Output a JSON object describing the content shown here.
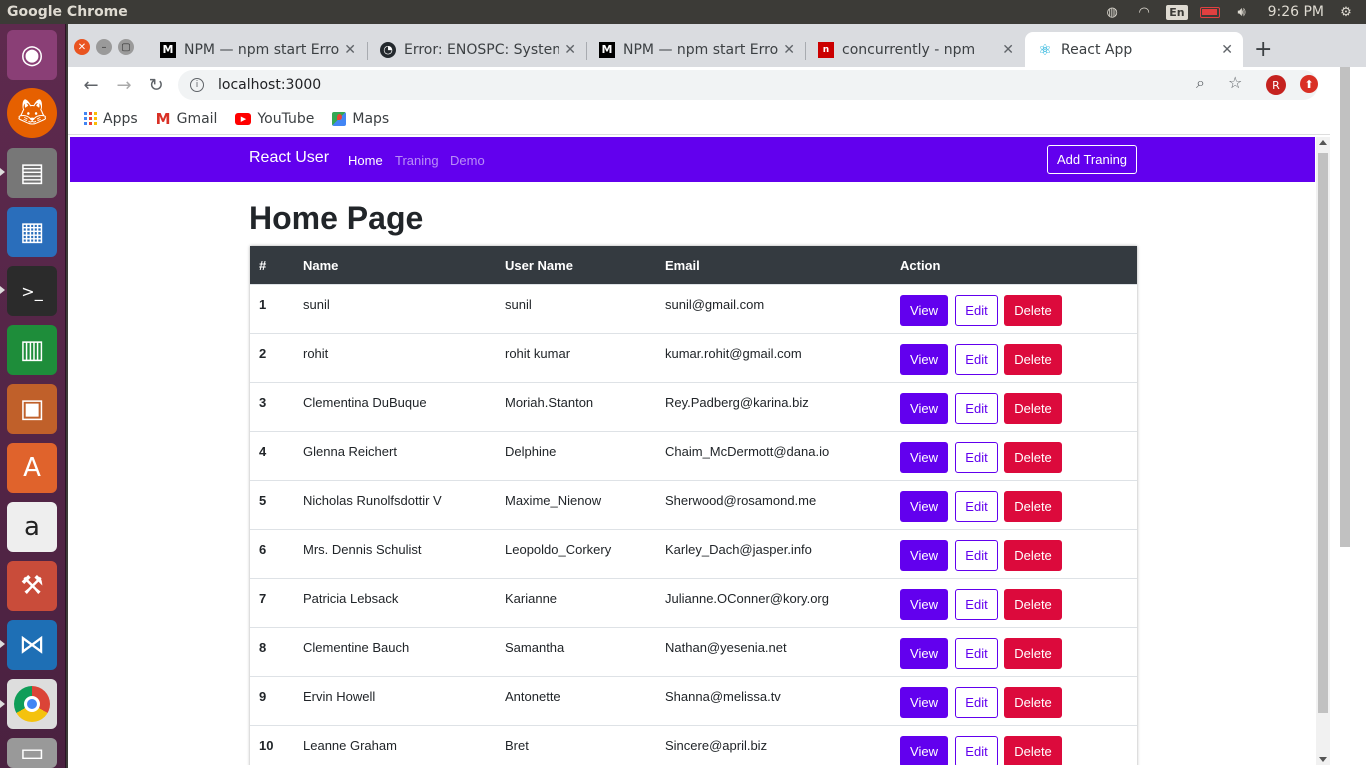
{
  "os": {
    "app_title": "Google Chrome",
    "lang": "En",
    "clock": "9:26 PM"
  },
  "browser": {
    "tabs": [
      {
        "title": "NPM — npm start Erro",
        "favicon": "M",
        "active": false
      },
      {
        "title": "Error: ENOSPC: System",
        "favicon": "github",
        "active": false
      },
      {
        "title": "NPM — npm start Erro",
        "favicon": "M",
        "active": false
      },
      {
        "title": "concurrently - npm",
        "favicon": "npm",
        "active": false
      },
      {
        "title": "React App",
        "favicon": "react",
        "active": true
      }
    ],
    "new_tab": "+",
    "url": "localhost:3000",
    "profile_initial": "R",
    "bookmarks": [
      "Apps",
      "Gmail",
      "YouTube",
      "Maps"
    ]
  },
  "app": {
    "brand": "React User",
    "nav": [
      "Home",
      "Traning",
      "Demo"
    ],
    "add_button": "Add Traning",
    "page_title": "Home Page",
    "table": {
      "headers": [
        "#",
        "Name",
        "User Name",
        "Email",
        "Action"
      ],
      "rows": [
        {
          "num": "1",
          "name": "sunil",
          "username": "sunil",
          "email": "sunil@gmail.com"
        },
        {
          "num": "2",
          "name": "rohit",
          "username": "rohit kumar",
          "email": "kumar.rohit@gmail.com"
        },
        {
          "num": "3",
          "name": "Clementina DuBuque",
          "username": "Moriah.Stanton",
          "email": "Rey.Padberg@karina.biz"
        },
        {
          "num": "4",
          "name": "Glenna Reichert",
          "username": "Delphine",
          "email": "Chaim_McDermott@dana.io"
        },
        {
          "num": "5",
          "name": "Nicholas Runolfsdottir V",
          "username": "Maxime_Nienow",
          "email": "Sherwood@rosamond.me"
        },
        {
          "num": "6",
          "name": "Mrs. Dennis Schulist",
          "username": "Leopoldo_Corkery",
          "email": "Karley_Dach@jasper.info"
        },
        {
          "num": "7",
          "name": "Patricia Lebsack",
          "username": "Karianne",
          "email": "Julianne.OConner@kory.org"
        },
        {
          "num": "8",
          "name": "Clementine Bauch",
          "username": "Samantha",
          "email": "Nathan@yesenia.net"
        },
        {
          "num": "9",
          "name": "Ervin Howell",
          "username": "Antonette",
          "email": "Shanna@melissa.tv"
        },
        {
          "num": "10",
          "name": "Leanne Graham",
          "username": "Bret",
          "email": "Sincere@april.biz"
        }
      ],
      "actions": {
        "view": "View",
        "edit": "Edit",
        "delete": "Delete"
      }
    },
    "colors": {
      "primary": "#6200ee",
      "danger": "#dc0a3c",
      "table_header": "#343a40"
    }
  }
}
